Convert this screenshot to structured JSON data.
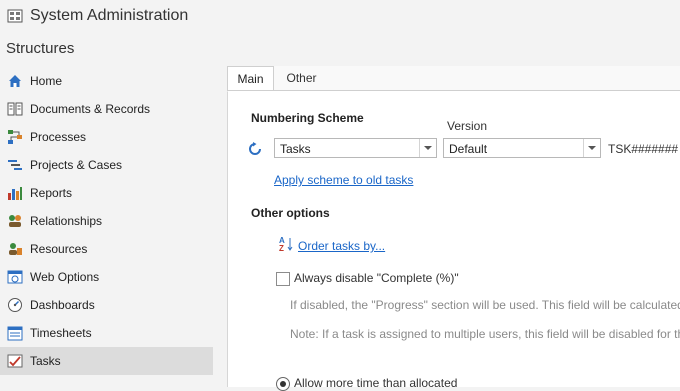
{
  "window": {
    "title": "System Administration"
  },
  "section": {
    "title": "Structures"
  },
  "sidebar": {
    "items": [
      {
        "label": "Home",
        "icon": "home-icon"
      },
      {
        "label": "Documents & Records",
        "icon": "documents-icon"
      },
      {
        "label": "Processes",
        "icon": "processes-icon"
      },
      {
        "label": "Projects & Cases",
        "icon": "projects-icon"
      },
      {
        "label": "Reports",
        "icon": "reports-icon"
      },
      {
        "label": "Relationships",
        "icon": "relationships-icon"
      },
      {
        "label": "Resources",
        "icon": "resources-icon"
      },
      {
        "label": "Web Options",
        "icon": "web-options-icon"
      },
      {
        "label": "Dashboards",
        "icon": "dashboards-icon"
      },
      {
        "label": "Timesheets",
        "icon": "timesheets-icon"
      },
      {
        "label": "Tasks",
        "icon": "tasks-icon",
        "selected": true
      }
    ]
  },
  "tabs": {
    "main": "Main",
    "other": "Other"
  },
  "numbering": {
    "heading": "Numbering Scheme",
    "version_label": "Version",
    "scheme_value": "Tasks",
    "version_value": "Default",
    "pattern": "TSK#######",
    "apply_link": "Apply scheme to old tasks"
  },
  "other_options": {
    "heading": "Other options",
    "order_link": "Order tasks by...",
    "disable_complete_label": "Always disable \"Complete (%)\"",
    "note1": "If disabled, the \"Progress\" section will be used. This field will be calculated au",
    "note2": "Note: If a task is assigned to multiple users, this field will be disabled for the",
    "allow_more_label": "Allow more time than allocated"
  },
  "colors": {
    "link": "#1a66c8",
    "selected_bg": "#dcdcdc"
  }
}
